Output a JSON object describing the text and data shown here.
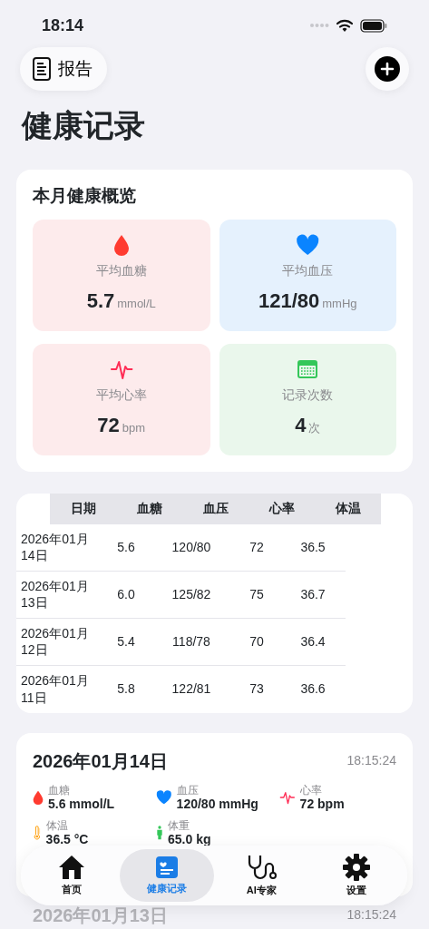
{
  "status_bar": {
    "time": "18:14"
  },
  "report_button": {
    "label": "报告"
  },
  "title": "健康记录",
  "overview": {
    "title": "本月健康概览",
    "tiles": [
      {
        "kind": "glucose",
        "label": "平均血糖",
        "value": "5.7",
        "unit": "mmol/L"
      },
      {
        "kind": "pressure",
        "label": "平均血压",
        "value": "121/80",
        "unit": "mmHg"
      },
      {
        "kind": "heart_rate",
        "label": "平均心率",
        "value": "72",
        "unit": "bpm"
      },
      {
        "kind": "count",
        "label": "记录次数",
        "value": "4",
        "unit": "次"
      }
    ]
  },
  "table": {
    "columns": [
      "日期",
      "血糖",
      "血压",
      "心率",
      "体温"
    ],
    "rows": [
      [
        "2026年01月14日",
        "5.6",
        "120/80",
        "72",
        "36.5"
      ],
      [
        "2026年01月13日",
        "6.0",
        "125/82",
        "75",
        "36.7"
      ],
      [
        "2026年01月12日",
        "5.4",
        "118/78",
        "70",
        "36.4"
      ],
      [
        "2026年01月11日",
        "5.8",
        "122/81",
        "73",
        "36.6"
      ]
    ]
  },
  "records": [
    {
      "date": "2026年01月14日",
      "time": "18:15:24",
      "metrics": [
        {
          "kind": "glucose",
          "label": "血糖",
          "value": "5.6 mmol/L"
        },
        {
          "kind": "pressure",
          "label": "血压",
          "value": "120/80 mmHg"
        },
        {
          "kind": "heart_rate",
          "label": "心率",
          "value": "72 bpm"
        },
        {
          "kind": "temperature",
          "label": "体温",
          "value": "36.5 °C"
        },
        {
          "kind": "weight",
          "label": "体重",
          "value": "65.0 kg"
        }
      ]
    },
    {
      "date": "2026年01月13日",
      "time": "18:15:24"
    }
  ],
  "tab_bar": {
    "items": [
      {
        "kind": "home",
        "label": "首页",
        "selected": false
      },
      {
        "kind": "records",
        "label": "健康记录",
        "selected": true
      },
      {
        "kind": "ai",
        "label": "AI专家",
        "selected": false
      },
      {
        "kind": "settings",
        "label": "设置",
        "selected": false
      }
    ]
  }
}
